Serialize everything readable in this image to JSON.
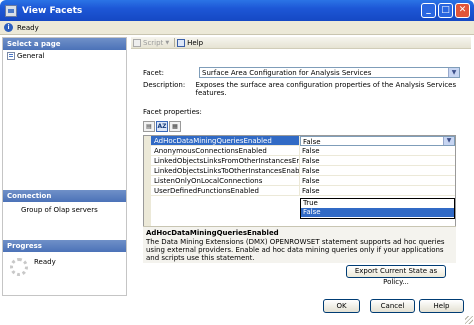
{
  "window": {
    "title": "View Facets",
    "controls": {
      "minimize": "_",
      "maximize": "□",
      "close": "✕"
    }
  },
  "status": {
    "text": "Ready",
    "icon": "info-icon"
  },
  "left_pane": {
    "select_page_header": "Select a page",
    "pages": [
      {
        "label": "General",
        "icon": "page-icon"
      }
    ],
    "connection_header": "Connection",
    "connection_text": "Group of Olap servers",
    "progress_header": "Progress",
    "progress_text": "Ready"
  },
  "toolbar": {
    "script_label": "Script",
    "help_label": "Help"
  },
  "facet": {
    "label": "Facet:",
    "selected": "Surface Area Configuration for Analysis Services",
    "description_label": "Description:",
    "description": "Exposes the surface area configuration properties of the Analysis Services features."
  },
  "properties": {
    "label": "Facet properties:",
    "toolbar": [
      "categorized-icon",
      "alphabetical-icon",
      "property-pages-icon"
    ],
    "rows": [
      {
        "name": "AdHocDataMiningQueriesEnabled",
        "value": "False"
      },
      {
        "name": "AnonymousConnectionsEnabled",
        "value": "False"
      },
      {
        "name": "LinkedObjectsLinksFromOtherInstancesEnabled",
        "value": "False"
      },
      {
        "name": "LinkedObjectsLinksToOtherInstancesEnabled",
        "value": "False"
      },
      {
        "name": "ListenOnlyOnLocalConnections",
        "value": "False"
      },
      {
        "name": "UserDefinedFunctionsEnabled",
        "value": "False"
      }
    ],
    "dropdown_options": [
      "True",
      "False"
    ],
    "selected_option": "False"
  },
  "description_box": {
    "title": "AdHocDataMiningQueriesEnabled",
    "body": "The Data Mining Extensions (DMX) OPENROWSET statement supports ad hoc queries using external providers. Enable ad hoc data mining queries only if your applications and scripts use this statement."
  },
  "export_label": "Export Current State as Policy...",
  "buttons": {
    "ok": "OK",
    "cancel": "Cancel",
    "help": "Help"
  },
  "colors": {
    "title_bar": "#1d57d6",
    "selection": "#316ac5",
    "header": "#4b72b8"
  }
}
